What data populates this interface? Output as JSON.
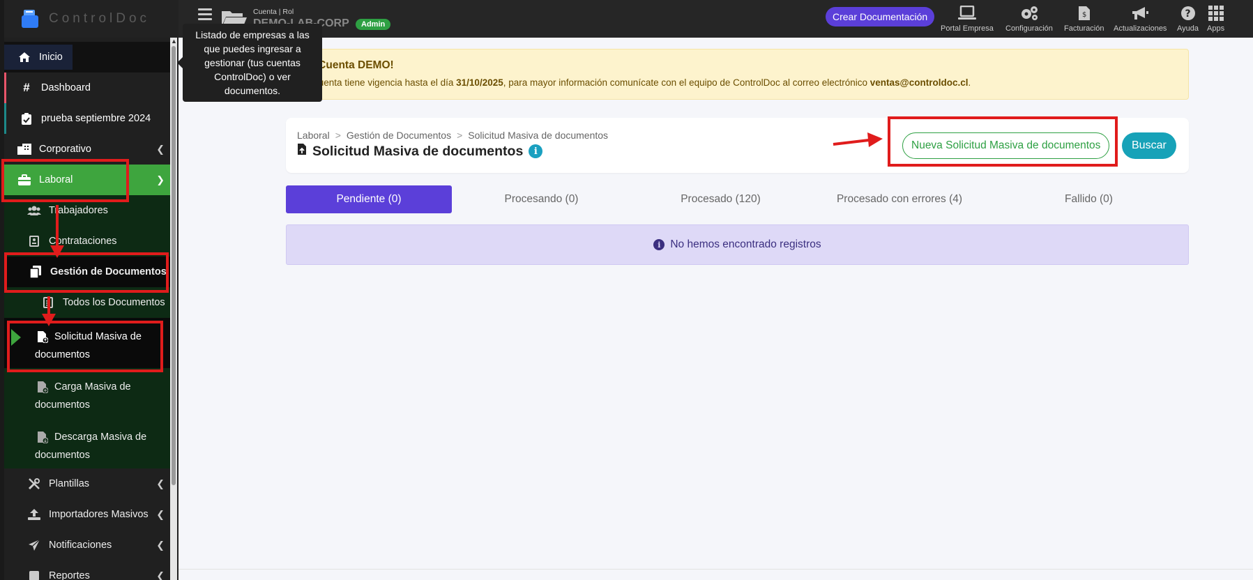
{
  "brand": {
    "name": "ControlDoc"
  },
  "topbar": {
    "account_label": "Cuenta | Rol",
    "account_name": "DEMO-LAB-CORP",
    "role": "Admin",
    "crear_label": "Crear Documentación",
    "items": [
      {
        "label": "Portal Empresa",
        "icon": "laptop-icon"
      },
      {
        "label": "Configuración",
        "icon": "gears-icon"
      },
      {
        "label": "Facturación",
        "icon": "invoice-icon"
      },
      {
        "label": "Actualizaciones",
        "icon": "megaphone-icon"
      },
      {
        "label": "Ayuda",
        "icon": "question-icon"
      },
      {
        "label": "Apps",
        "icon": "grid-icon"
      }
    ]
  },
  "tooltip": {
    "text": "Listado de empresas a las que puedes ingresar a gestionar (tus cuentas ControlDoc) o ver documentos."
  },
  "sidebar": {
    "inicio": "Inicio",
    "dashboard": "Dashboard",
    "prueba": "prueba septiembre 2024",
    "corporativo": "Corporativo",
    "laboral": "Laboral",
    "trabajadores": "Trabajadores",
    "contrataciones": "Contrataciones",
    "gestion": "Gestión de Documentos",
    "todos": "Todos los Documentos",
    "solicitud_1": "Solicitud Masiva de",
    "solicitud_2": "documentos",
    "carga_1": "Carga Masiva de",
    "carga_2": "documentos",
    "descarga_1": "Descarga Masiva de",
    "descarga_2": "documentos",
    "plantillas": "Plantillas",
    "importadores": "Importadores Masivos",
    "notificaciones": "Notificaciones",
    "reportes": "Reportes"
  },
  "banner": {
    "title": "¡Cuenta DEMO!",
    "text_pre": "Tu cuenta tiene vigencia hasta el día ",
    "date": "31/10/2025",
    "text_mid": ", para mayor información comunícate con el equipo de ControlDoc al correo electrónico ",
    "email": "ventas@controldoc.cl",
    "text_post": "."
  },
  "card": {
    "breadcrumb": [
      "Laboral",
      "Gestión de Documentos",
      "Solicitud Masiva de documentos"
    ],
    "breadcrumb_sep": ">",
    "title": "Solicitud Masiva de documentos",
    "nueva_label": "Nueva Solicitud Masiva de documentos",
    "buscar_label": "Buscar"
  },
  "tabs": [
    {
      "label": "Pendiente (0)"
    },
    {
      "label": "Procesando (0)"
    },
    {
      "label": "Procesado (120)"
    },
    {
      "label": "Procesado con errores (4)"
    },
    {
      "label": "Fallido (0)"
    }
  ],
  "empty_message": "No hemos encontrado registros",
  "colors": {
    "accent_purple": "#5b3fd9",
    "laboral_green": "#3ea53e",
    "annotation_red": "#e01c1c",
    "buscar_teal": "#17a2b8"
  }
}
